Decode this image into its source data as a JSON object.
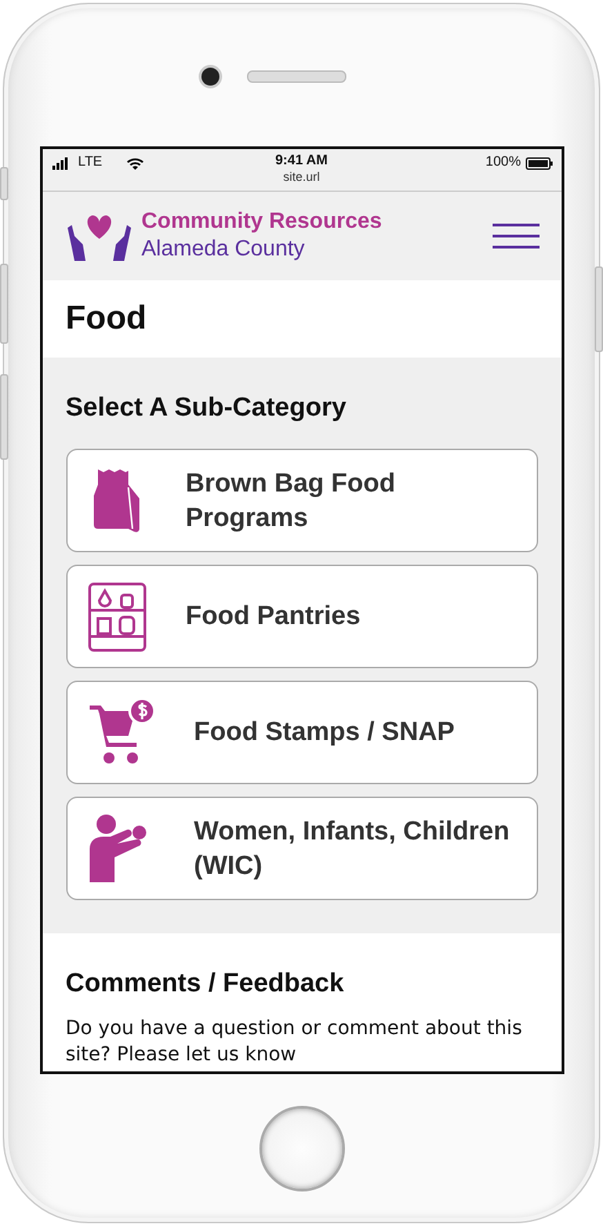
{
  "status_bar": {
    "carrier": "LTE",
    "time": "9:41 AM",
    "url": "site.url",
    "battery": "100%"
  },
  "header": {
    "title": "Community Resources",
    "subtitle": "Alameda County"
  },
  "page_title": "Food",
  "subcategories": {
    "title": "Select A Sub-Category",
    "items": [
      {
        "kind": "bag",
        "label": "Brown Bag Food Programs"
      },
      {
        "kind": "pantry",
        "label": "Food Pantries"
      },
      {
        "kind": "cart",
        "label": "Food Stamps / SNAP"
      },
      {
        "kind": "parent",
        "label": "Women, Infants, Children (WIC)"
      }
    ]
  },
  "feedback": {
    "title": "Comments / Feedback",
    "text": "Do you have a question or comment about this site? Please let us know"
  }
}
